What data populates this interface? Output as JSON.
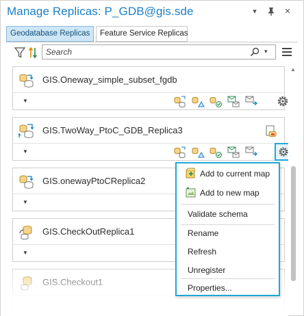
{
  "window": {
    "title": "Manage Replicas: P_GDB@gis.sde",
    "menu_glyph": "▾",
    "pin_glyph": "📌",
    "close_glyph": "✕"
  },
  "tabs": [
    {
      "label": "Geodatabase Replicas",
      "active": true
    },
    {
      "label": "Feature Service Replicas",
      "active": false
    }
  ],
  "toolbar": {
    "search_placeholder": "Search",
    "search_dropdown_glyph": "▾"
  },
  "replicas": [
    {
      "name": "GIS.Oneway_simple_subset_fgdb",
      "icon": "oneway-replica-icon",
      "badge": null,
      "gear_selected": false
    },
    {
      "name": "GIS.TwoWay_PtoC_GDB_Replica3",
      "icon": "twoway-replica-icon",
      "badge": "warning-badge-icon",
      "gear_selected": true
    },
    {
      "name": "GIS.onewayPtoCReplica2",
      "icon": "oneway-replica-icon",
      "badge": null,
      "gear_selected": false
    },
    {
      "name": "GIS.CheckOutReplica1",
      "icon": "checkout-replica-icon",
      "badge": null,
      "gear_selected": false
    },
    {
      "name": "GIS.Checkout1",
      "icon": "checkout-replica-icon",
      "badge": null,
      "gear_selected": false
    }
  ],
  "card_expand_glyph": "▼",
  "context_menu": {
    "items": [
      {
        "label": "Add to current map",
        "icon": "add-to-current-map-icon"
      },
      {
        "label": "Add to new map",
        "icon": "add-to-new-map-icon"
      },
      {
        "label": "Validate schema",
        "icon": null
      },
      {
        "label": "Rename",
        "icon": null
      },
      {
        "label": "Refresh",
        "icon": null
      },
      {
        "label": "Unregister",
        "icon": null
      },
      {
        "label": "Properties...",
        "icon": null
      }
    ]
  },
  "scrollbar": {
    "up_glyph": "▲"
  },
  "colors": {
    "title": "#1b7fc4",
    "accent_border": "#1ea7d8",
    "active_tab_bg": "#cfe6f6"
  }
}
